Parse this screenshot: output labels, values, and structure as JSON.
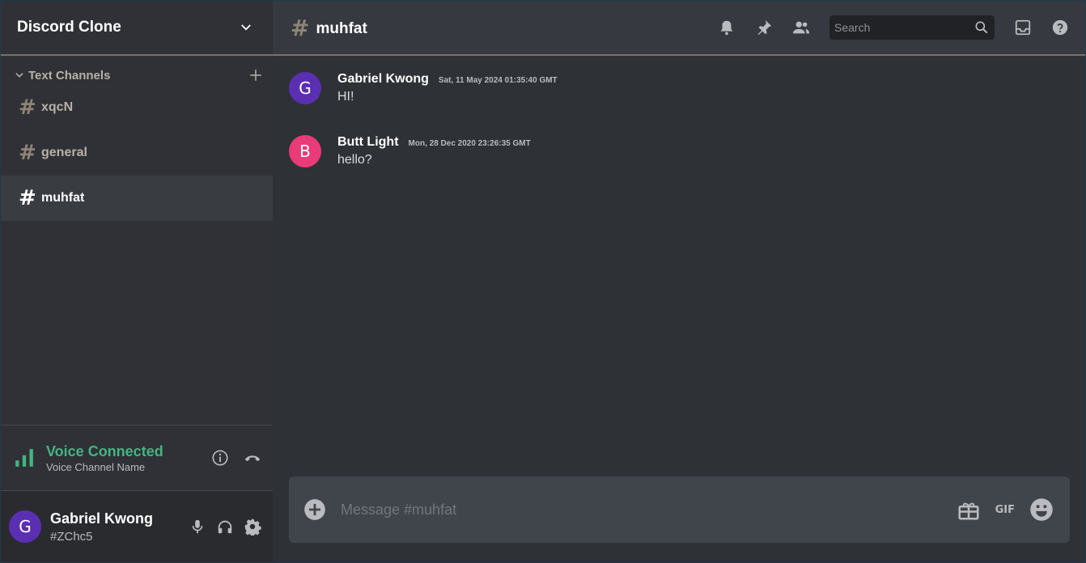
{
  "server": {
    "name": "Discord Clone",
    "menu_icon": "chevron-down-icon"
  },
  "sidebar": {
    "category": "Text Channels",
    "channels": [
      {
        "name": "xqcN",
        "active": false
      },
      {
        "name": "general",
        "active": false
      },
      {
        "name": "muhfat",
        "active": true
      }
    ]
  },
  "voice": {
    "status": "Voice Connected",
    "channel": "Voice Channel Name"
  },
  "user": {
    "avatar_letter": "G",
    "name": "Gabriel Kwong",
    "tag": "#ZChc5"
  },
  "header": {
    "channel_name": "muhfat",
    "search_placeholder": "Search"
  },
  "messages": [
    {
      "avatar_letter": "G",
      "avatar_color": "#5b2fb2",
      "author": "Gabriel Kwong",
      "timestamp": "Sat, 11 May 2024 01:35:40 GMT",
      "text": "HI!"
    },
    {
      "avatar_letter": "B",
      "avatar_color": "#e93b77",
      "author": "Butt Light",
      "timestamp": "Mon, 28 Dec 2020 23:26:35 GMT",
      "text": "hello?"
    }
  ],
  "composer": {
    "placeholder": "Message #muhfat",
    "gif_label": "GIF"
  },
  "colors": {
    "voice_connected": "#43b581",
    "accent_border": "#7b7165"
  }
}
